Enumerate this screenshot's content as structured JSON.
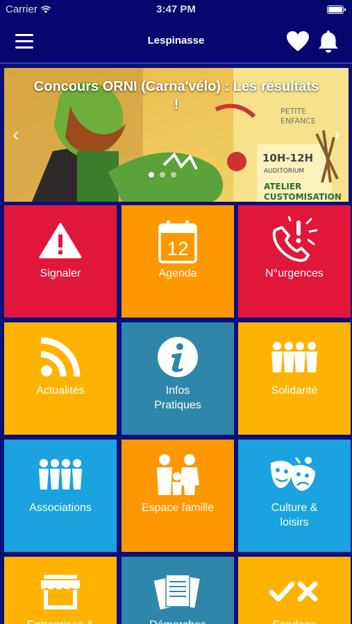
{
  "status_bar": {
    "carrier": "Carrier",
    "time": "3:47 PM"
  },
  "nav": {
    "title": "Lespinasse"
  },
  "carousel": {
    "headline": "Concours ORNI (Carna'vélo) : Les résultats !",
    "slide_count": 3,
    "active_index": 0
  },
  "colors": {
    "red": "#e0173a",
    "orange": "#ff9800",
    "amber": "#ffb300",
    "teal": "#2e86ab",
    "sky": "#1aa3df"
  },
  "tiles": [
    {
      "label": "Signaler",
      "icon": "warning-icon",
      "color": "red"
    },
    {
      "label": "Agenda",
      "icon": "calendar-icon",
      "color": "orange",
      "icon_text": "12"
    },
    {
      "label": "N°urgences",
      "icon": "emergency-phone-icon",
      "color": "red"
    },
    {
      "label": "Actualités",
      "icon": "rss-icon",
      "color": "amber"
    },
    {
      "label": "Infos Pratiques",
      "icon": "info-icon",
      "color": "teal",
      "label_lines": [
        "Infos",
        "Pratiques"
      ]
    },
    {
      "label": "Solidarité",
      "icon": "people-icon",
      "color": "amber"
    },
    {
      "label": "Associations",
      "icon": "group-icon",
      "color": "sky"
    },
    {
      "label": "Espace famille",
      "icon": "family-icon",
      "color": "orange"
    },
    {
      "label": "Culture & loisirs",
      "icon": "theatre-masks-icon",
      "color": "sky",
      "label_lines": [
        "Culture &",
        "loisirs"
      ]
    },
    {
      "label": "Entreprises &",
      "icon": "shop-icon",
      "color": "amber"
    },
    {
      "label": "Démarches",
      "icon": "documents-icon",
      "color": "teal"
    },
    {
      "label": "Sondage",
      "icon": "check-cross-icon",
      "color": "amber"
    }
  ]
}
